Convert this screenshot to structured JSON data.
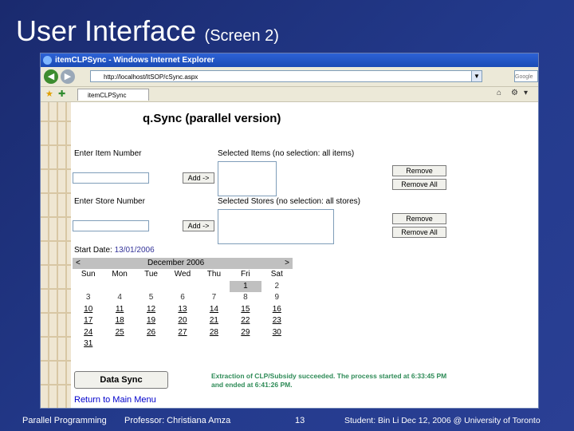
{
  "slide": {
    "title": "User Interface",
    "subtitle": "(Screen 2)",
    "footer": {
      "course": "Parallel Programming",
      "professor": "Professor: Christiana Amza",
      "page": "13",
      "student": "Student: Bin Li  Dec 12, 2006 @ University of Toronto"
    }
  },
  "browser": {
    "window_title": "itemCLPSync - Windows Internet Explorer",
    "url": "http://localhost/ItSOP/cSync.aspx",
    "search_placeholder": "Google",
    "tab_label": "itemCLPSync"
  },
  "page": {
    "title": "q.Sync (parallel version)",
    "item_section": {
      "enter_label": "Enter Item Number",
      "add_button": "Add ->",
      "selected_label": "Selected Items (no selection: all items)",
      "remove_button": "Remove",
      "remove_all_button": "Remove All"
    },
    "store_section": {
      "enter_label": "Enter Store Number",
      "add_button": "Add ->",
      "selected_label": "Selected Stores (no selection: all stores)",
      "remove_button": "Remove",
      "remove_all_button": "Remove All"
    },
    "start_date_label": "Start Date:",
    "start_date_value": "13/01/2006",
    "calendar": {
      "prev": "<",
      "next": ">",
      "month": "December 2006",
      "days_of_week": [
        "Sun",
        "Mon",
        "Tue",
        "Wed",
        "Thu",
        "Fri",
        "Sat"
      ],
      "weeks": [
        [
          "",
          "",
          "",
          "",
          "",
          "1",
          "2"
        ],
        [
          "3",
          "4",
          "5",
          "6",
          "7",
          "8",
          "9"
        ],
        [
          "10",
          "11",
          "12",
          "13",
          "14",
          "15",
          "16"
        ],
        [
          "17",
          "18",
          "19",
          "20",
          "21",
          "22",
          "23"
        ],
        [
          "24",
          "25",
          "26",
          "27",
          "28",
          "29",
          "30"
        ],
        [
          "31",
          "",
          "",
          "",
          "",
          "",
          ""
        ]
      ]
    },
    "sync_button": "Data Sync",
    "return_link": "Return to Main Menu",
    "status_message": "Extraction of CLP/Subsidy succeeded. The process started at 6:33:45 PM and ended at 6:41:26 PM."
  },
  "colors": {
    "slide_background": "#233a8c",
    "title_bar": "#2d62d6",
    "status_text": "#2e8b57",
    "link": "#0000cc"
  }
}
